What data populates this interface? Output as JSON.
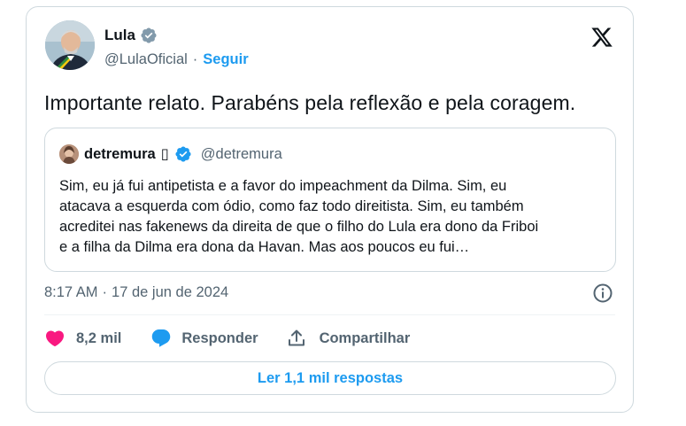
{
  "author": {
    "name": "Lula",
    "handle": "@LulaOficial",
    "follow_label": "Seguir",
    "verified_icon": "verified-badge-icon"
  },
  "tweet": {
    "text": "Importante relato. Parabéns pela reflexão e pela coragem.",
    "time": "8:17 AM",
    "separator": "·",
    "date": "17 de jun de 2024"
  },
  "quoted": {
    "name": "detremura",
    "name_suffix": "▯",
    "handle": "@detremura",
    "lines": [
      "Sim, eu já fui antipetista e a favor do impeachment da Dilma. Sim, eu",
      "atacava a esquerda com ódio, como faz todo direitista. Sim, eu também",
      "acreditei nas fakenews da direita de que o filho do Lula era dono da Friboi",
      "e a filha da Dilma era dona da Havan. Mas aos poucos eu fui…"
    ]
  },
  "actions": {
    "likes": "8,2 mil",
    "reply_label": "Responder",
    "share_label": "Compartilhar"
  },
  "read_replies_label": "Ler 1,1 mil respostas",
  "colors": {
    "accent": "#1d9bf0",
    "like": "#f91880",
    "muted": "#536471",
    "border": "#cfd9de"
  }
}
